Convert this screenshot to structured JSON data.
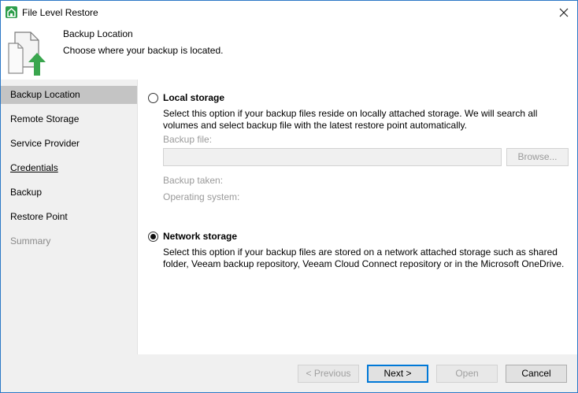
{
  "window": {
    "title": "File Level Restore",
    "close_glyph": "×"
  },
  "header": {
    "title": "Backup Location",
    "subtitle": "Choose where your backup is located."
  },
  "nav": {
    "items": [
      {
        "label": "Backup Location",
        "state": "active"
      },
      {
        "label": "Remote Storage",
        "state": "normal"
      },
      {
        "label": "Service Provider",
        "state": "normal"
      },
      {
        "label": "Credentials",
        "state": "underlined"
      },
      {
        "label": "Backup",
        "state": "normal"
      },
      {
        "label": "Restore Point",
        "state": "normal"
      },
      {
        "label": "Summary",
        "state": "disabled"
      }
    ]
  },
  "local": {
    "title": "Local storage",
    "selected": false,
    "description_line1": "Select this option if your backup files reside on locally attached storage. We will search all",
    "description_line2": "volumes and select backup file with the latest restore point automatically.",
    "backup_file_label": "Backup file:",
    "backup_file_value": "",
    "browse_label": "Browse...",
    "backup_taken_label": "Backup taken:",
    "os_label": "Operating system:"
  },
  "network": {
    "title": "Network storage",
    "selected": true,
    "description_line1": "Select this option if your backup files are stored on a network attached storage such as shared",
    "description_line2": "folder, Veeam backup repository, Veeam Cloud Connect repository or in the Microsoft OneDrive."
  },
  "footer": {
    "previous": "< Previous",
    "next": "Next >",
    "open": "Open",
    "cancel": "Cancel"
  },
  "colors": {
    "accent": "#0078d7",
    "nav_active": "#c4c4c4",
    "icon_green": "#2e9e4b"
  },
  "icons": {
    "app": "restore-app-icon",
    "header": "file-restore-icon",
    "close": "close-icon"
  }
}
